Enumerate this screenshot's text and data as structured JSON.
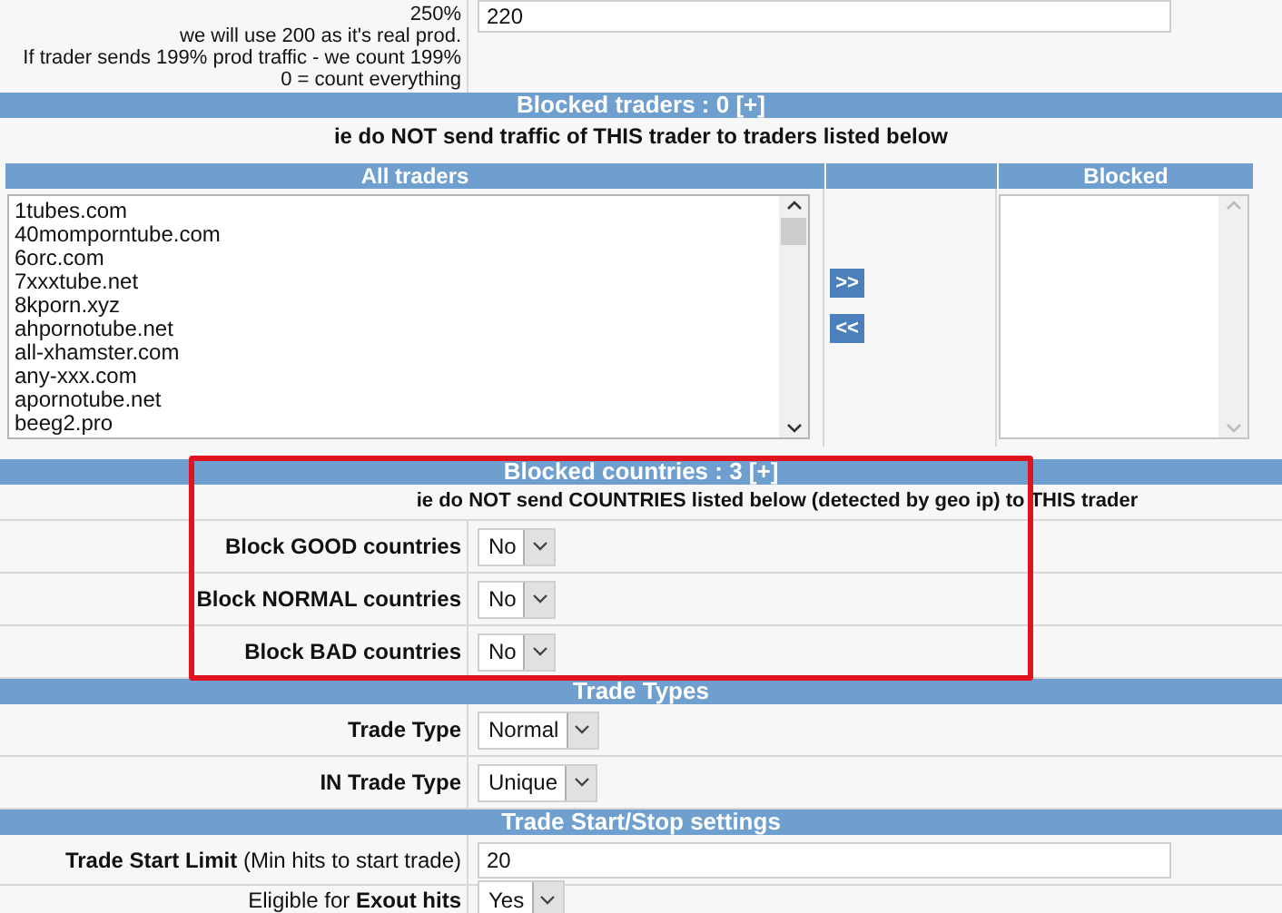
{
  "top_row": {
    "label_lines": [
      "250%",
      "we will use 200 as it's real prod.",
      "If trader sends 199% prod traffic - we count 199%",
      "0 = count everything"
    ],
    "value": "220"
  },
  "blocked_traders": {
    "title": "Blocked traders : 0 [+]",
    "subtitle": "ie do NOT send traffic of THIS trader to traders listed below",
    "all_heading": "All traders",
    "blocked_heading": "Blocked",
    "all_traders": [
      "1tubes.com",
      "40momporntube.com",
      "6orc.com",
      "7xxxtube.net",
      "8kporn.xyz",
      "ahpornotube.net",
      "all-xhamster.com",
      "any-xxx.com",
      "apornotube.net",
      "beeg2.pro"
    ],
    "buttons": [
      ">>",
      "<<"
    ]
  },
  "blocked_countries": {
    "title": "Blocked countries : 3 [+]",
    "subtitle": "ie do NOT send COUNTRIES listed below (detected by geo ip) to THIS trader",
    "rows": [
      {
        "label": "Block GOOD countries",
        "value": "No"
      },
      {
        "label": "Block NORMAL countries",
        "value": "No"
      },
      {
        "label": "Block BAD countries",
        "value": "No"
      }
    ]
  },
  "trade_types": {
    "title": "Trade Types",
    "rows": [
      {
        "label": "Trade Type",
        "value": "Normal"
      },
      {
        "label": "IN Trade Type",
        "value": "Unique"
      }
    ]
  },
  "start_stop": {
    "title": "Trade Start/Stop settings",
    "rows": [
      {
        "kind": "input",
        "label": "**Trade Start Limit** (Min hits to start trade)",
        "value": "20"
      },
      {
        "kind": "select",
        "label": "Eligible for **Exout hits**",
        "value": "Yes"
      }
    ]
  }
}
